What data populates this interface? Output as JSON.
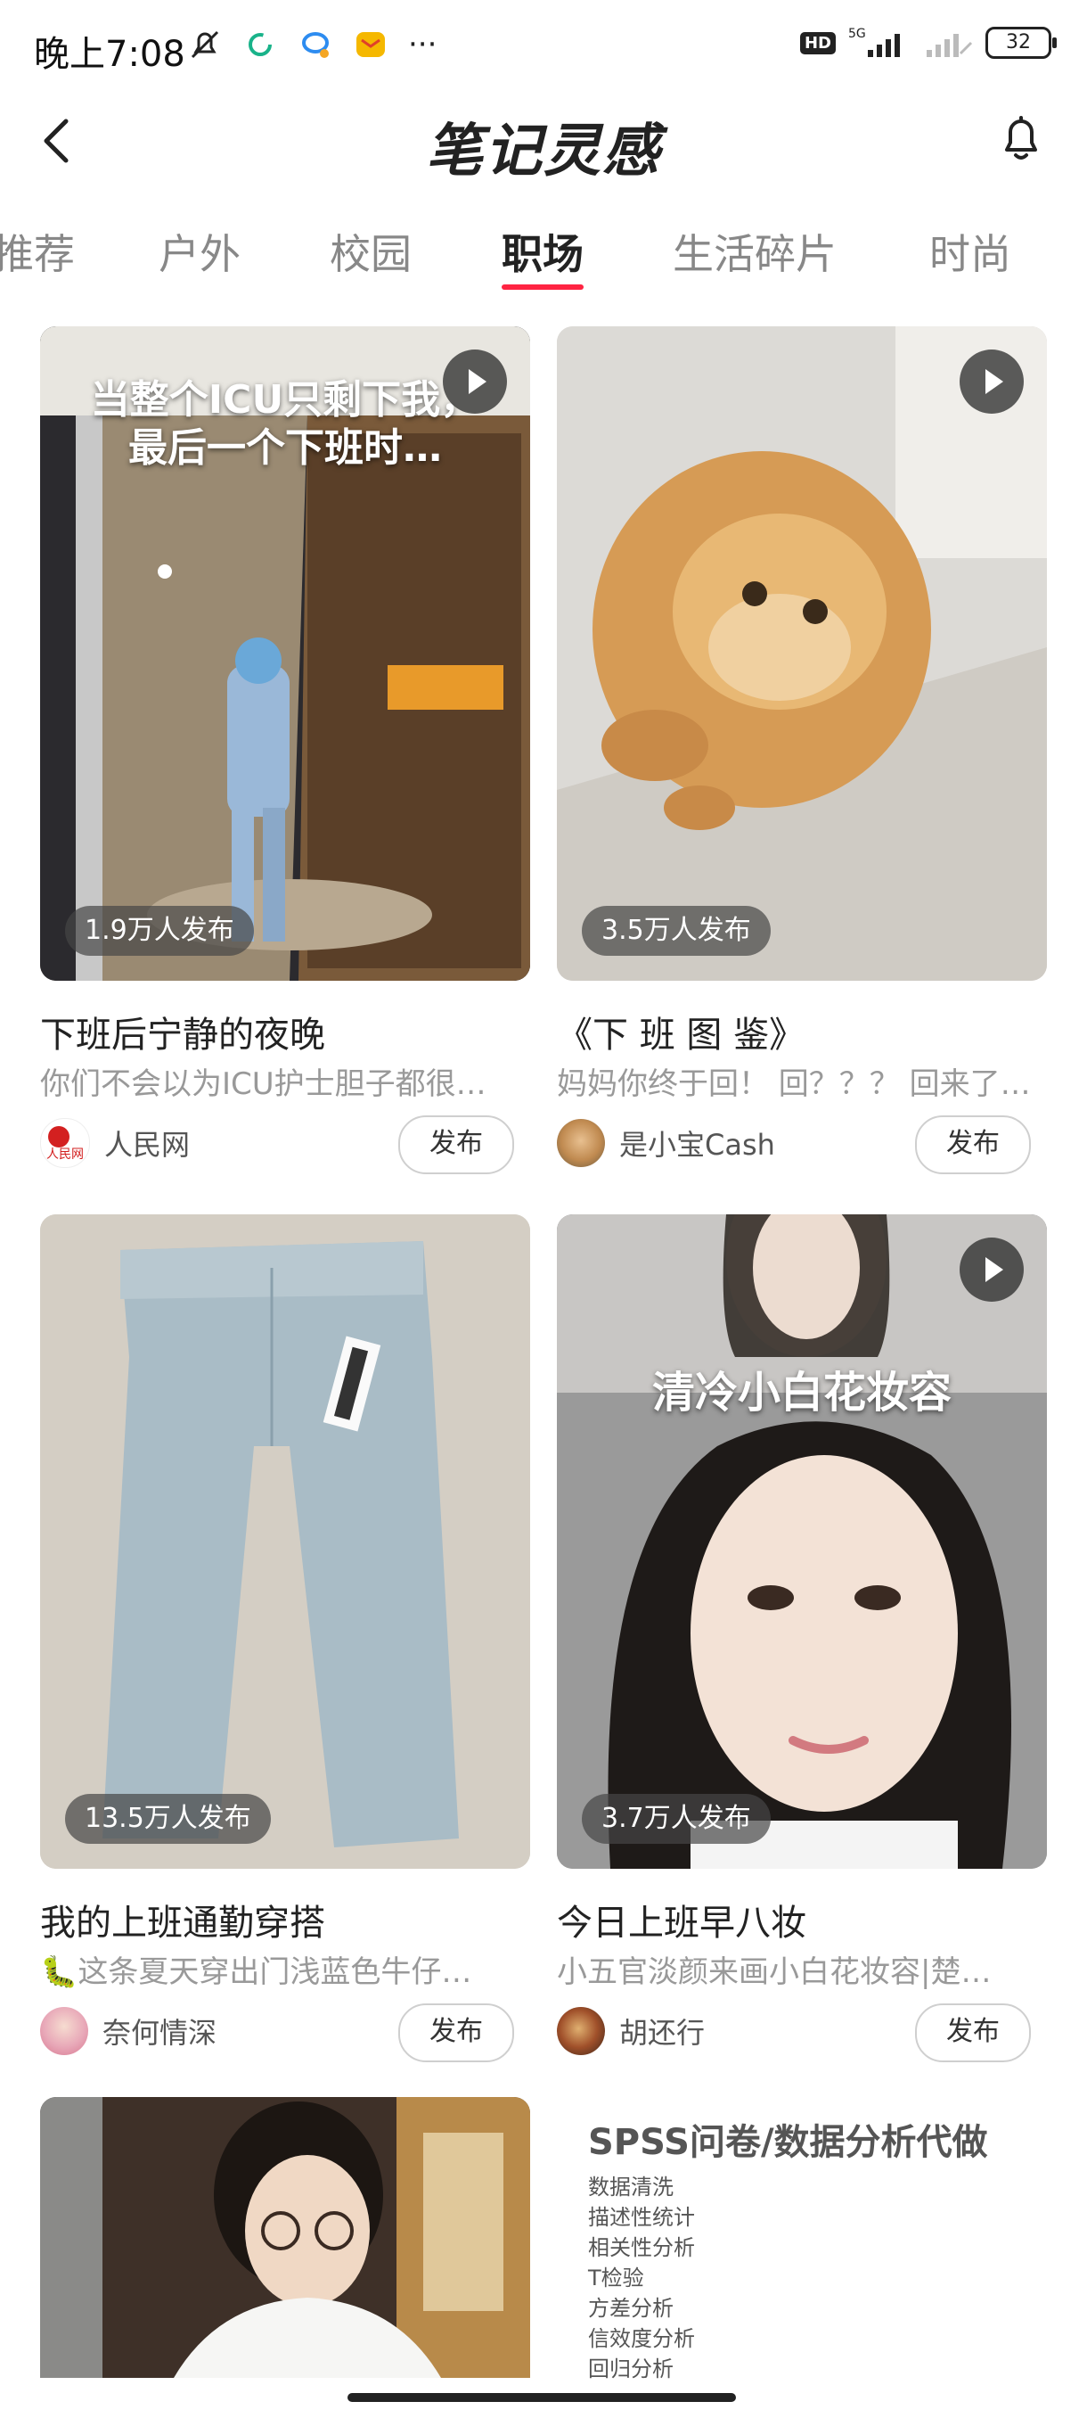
{
  "status_bar": {
    "time": "晚上7:08",
    "network": "5G",
    "hd": "HD",
    "battery": "32",
    "more": "···"
  },
  "header": {
    "title": "笔记灵感"
  },
  "tabs": [
    {
      "label": "推荐"
    },
    {
      "label": "户外"
    },
    {
      "label": "校园"
    },
    {
      "label": "职场"
    },
    {
      "label": "生活碎片"
    },
    {
      "label": "时尚"
    }
  ],
  "active_tab_index": 3,
  "accent_color": "#ff2442",
  "cards": [
    {
      "overlay_text": "当整个ICU只剩下我，\n最后一个下班时…",
      "is_video": true,
      "count": "1.9万人发布",
      "title": "下班后宁静的夜晚",
      "desc": "你们不会以为ICU护士胆子都很…",
      "author": "人民网",
      "button": "发布"
    },
    {
      "overlay_text": "",
      "is_video": true,
      "count": "3.5万人发布",
      "title": "《下 班 图 鉴》",
      "desc": "妈妈你终于回！ 回？？？ 回来了…",
      "author": "是小宝Cash",
      "button": "发布"
    },
    {
      "overlay_text": "",
      "is_video": false,
      "count": "13.5万人发布",
      "title": "我的上班通勤穿搭",
      "desc": "🐛这条夏天穿出门浅蓝色牛仔…",
      "author": "奈何情深",
      "button": "发布"
    },
    {
      "overlay_text": "清冷小白花妆容",
      "is_video": true,
      "count": "3.7万人发布",
      "title": "今日上班早八妆",
      "desc": "小五官淡颜来画小白花妆容|楚…",
      "author": "胡还行",
      "button": "发布"
    }
  ],
  "bottom_right_card": {
    "title": "SPSS问卷/数据分析代做",
    "items": [
      "数据清洗",
      "描述性统计",
      "相关性分析",
      "T检验",
      "方差分析",
      "信效度分析",
      "回归分析"
    ]
  }
}
